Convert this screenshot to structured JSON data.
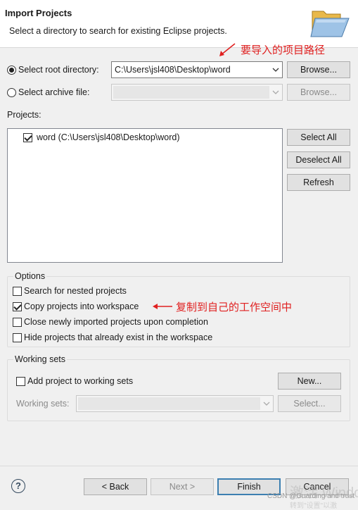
{
  "header": {
    "title": "Import Projects",
    "description": "Select a directory to search for existing Eclipse projects.",
    "icon": "folder-import-icon"
  },
  "annotations": {
    "root_path_note": "要导入的项目路径",
    "copy_note": "复制到自己的工作空间中",
    "color": "#e02020"
  },
  "source": {
    "root_label": "Select root directory:",
    "root_value": "C:\\Users\\jsl408\\Desktop\\word",
    "root_selected": true,
    "archive_label": "Select archive file:",
    "archive_value": "",
    "archive_selected": false,
    "browse_label": "Browse...",
    "browse_archive_label": "Browse..."
  },
  "projects": {
    "label": "Projects:",
    "items": [
      {
        "label": "word (C:\\Users\\jsl408\\Desktop\\word)",
        "checked": true
      }
    ],
    "select_all": "Select All",
    "deselect_all": "Deselect All",
    "refresh": "Refresh"
  },
  "options": {
    "title": "Options",
    "items": [
      {
        "label": "Search for nested projects",
        "checked": false
      },
      {
        "label": "Copy projects into workspace",
        "checked": true
      },
      {
        "label": "Close newly imported projects upon completion",
        "checked": false
      },
      {
        "label": "Hide projects that already exist in the workspace",
        "checked": false
      }
    ]
  },
  "working_sets": {
    "title": "Working sets",
    "add_label": "Add project to working sets",
    "add_checked": false,
    "new_button": "New...",
    "sets_label": "Working sets:",
    "select_button": "Select..."
  },
  "footer": {
    "help": "?",
    "back": "< Back",
    "next": "Next >",
    "finish": "Finish",
    "cancel": "Cancel"
  },
  "watermarks": {
    "csdn": "CSDN @Guarding and trust",
    "windows_activate": "激活 Windo",
    "windows_settings": "转到\"设置\"以激"
  }
}
